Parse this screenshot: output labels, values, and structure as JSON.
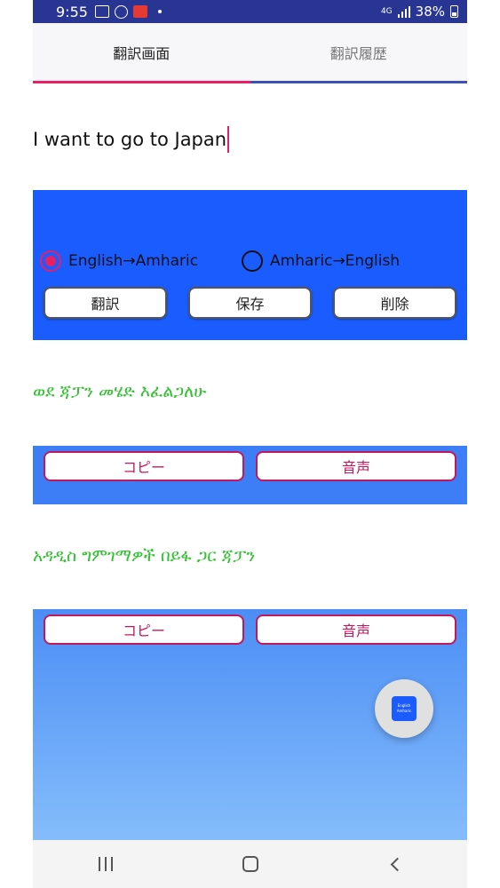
{
  "status_bar": {
    "time": "9:55",
    "network": "4G",
    "battery": "38%",
    "left_icons": [
      "image-icon",
      "chrome-icon",
      "app-notification-icon"
    ],
    "right_icons": [
      "wifi-data-icon",
      "signal-icon",
      "battery-icon"
    ]
  },
  "tabs": [
    {
      "label": "翻訳画面",
      "active": true
    },
    {
      "label": "翻訳履歴",
      "active": false
    }
  ],
  "input": {
    "value": "I want to go to Japan"
  },
  "direction": {
    "options": [
      {
        "label": "English→Amharic",
        "selected": true
      },
      {
        "label": "Amharic→English",
        "selected": false
      }
    ]
  },
  "actions": {
    "translate": "翻訳",
    "save": "保存",
    "delete": "削除"
  },
  "result1": {
    "text": "ወደ ጃፓን መሄድ እፈልጋለሁ",
    "copy": "コピー",
    "speak": "音声"
  },
  "result2": {
    "text": "አዳዲስ ግምገማዎች በይፋ ጋር ጃፓን",
    "copy": "コピー",
    "speak": "音声"
  },
  "fab": {
    "logo_line1": "English",
    "logo_line2": "Amharic"
  },
  "colors": {
    "accent": "#e91e63",
    "panel_blue": "#1a5cff",
    "result_green": "#31c231",
    "button_border_red": "#c2185b"
  }
}
